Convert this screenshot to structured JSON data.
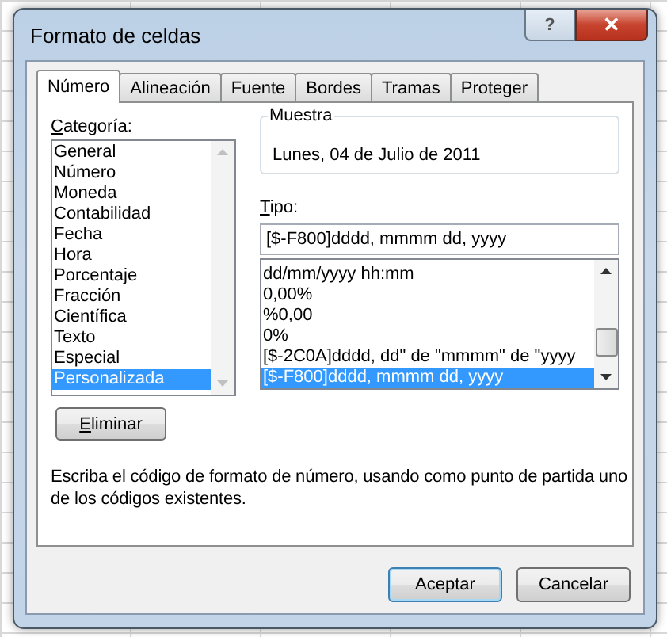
{
  "window": {
    "title": "Formato de celdas",
    "help_button": "?",
    "close_button": "✕"
  },
  "tabs": [
    {
      "label": "Número",
      "selected": true
    },
    {
      "label": "Alineación",
      "selected": false
    },
    {
      "label": "Fuente",
      "selected": false
    },
    {
      "label": "Bordes",
      "selected": false
    },
    {
      "label": "Tramas",
      "selected": false
    },
    {
      "label": "Proteger",
      "selected": false
    }
  ],
  "category": {
    "label_accel": "C",
    "label_rest": "ategoría:",
    "items": [
      {
        "label": "General",
        "selected": false
      },
      {
        "label": "Número",
        "selected": false
      },
      {
        "label": "Moneda",
        "selected": false
      },
      {
        "label": "Contabilidad",
        "selected": false
      },
      {
        "label": "Fecha",
        "selected": false
      },
      {
        "label": "Hora",
        "selected": false
      },
      {
        "label": "Porcentaje",
        "selected": false
      },
      {
        "label": "Fracción",
        "selected": false
      },
      {
        "label": "Científica",
        "selected": false
      },
      {
        "label": "Texto",
        "selected": false
      },
      {
        "label": "Especial",
        "selected": false
      },
      {
        "label": "Personalizada",
        "selected": true
      }
    ]
  },
  "sample": {
    "label": "Muestra",
    "value": "Lunes, 04 de Julio de 2011"
  },
  "type": {
    "label_accel": "T",
    "label_rest": "ipo:",
    "value": "[$-F800]dddd, mmmm dd, yyyy",
    "items": [
      {
        "label": "dd/mm/yyyy hh:mm",
        "selected": false
      },
      {
        "label": "0,00%",
        "selected": false
      },
      {
        "label": "%0,00",
        "selected": false
      },
      {
        "label": "0%",
        "selected": false
      },
      {
        "label": "[$-2C0A]dddd, dd\" de \"mmmm\" de \"yyyy",
        "selected": false
      },
      {
        "label": "[$-F800]dddd, mmmm dd, yyyy",
        "selected": true
      }
    ]
  },
  "delete_button": {
    "accel": "E",
    "rest": "liminar"
  },
  "description": "Escriba el código de formato de número, usando como punto de partida uno de los códigos existentes.",
  "buttons": [
    {
      "label": "Aceptar",
      "default": true
    },
    {
      "label": "Cancelar",
      "default": false
    }
  ]
}
